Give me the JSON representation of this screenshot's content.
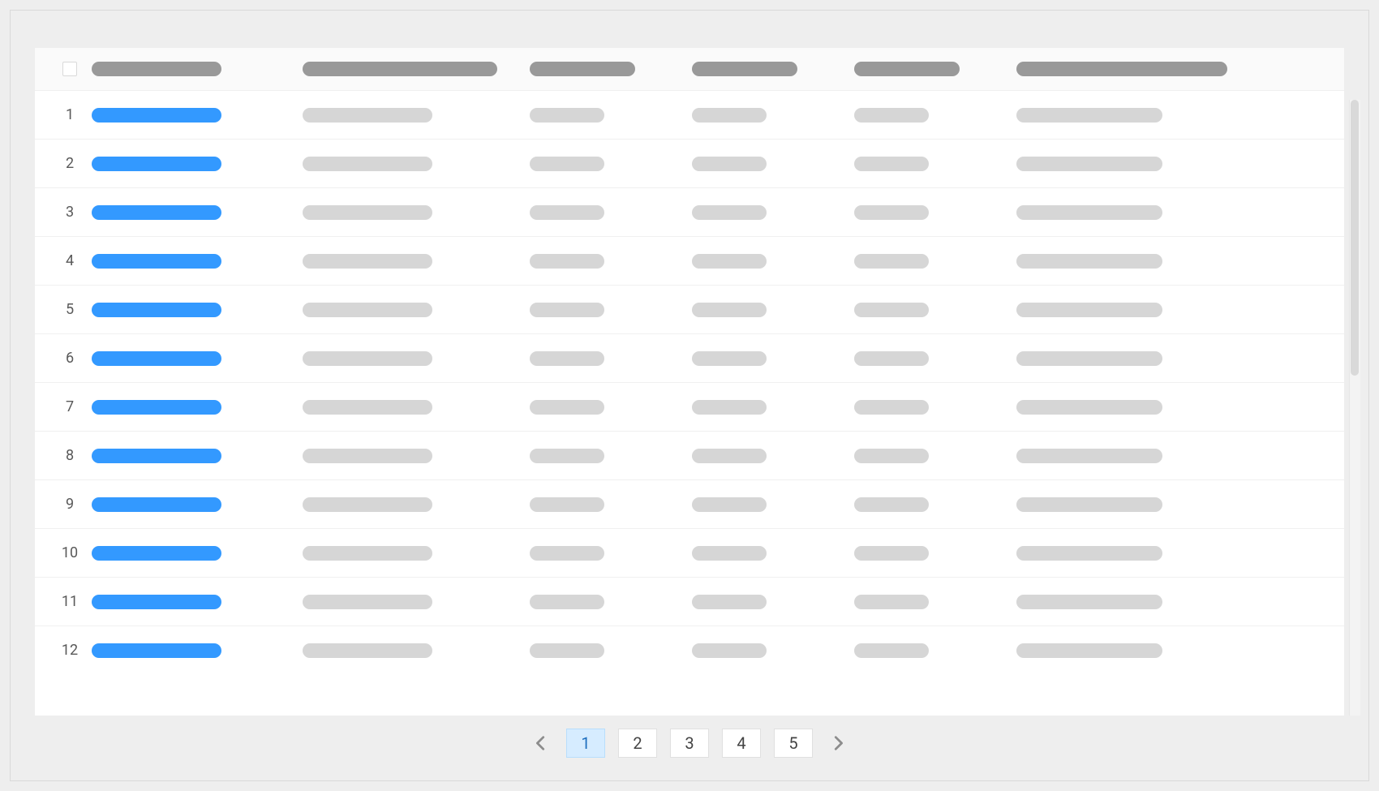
{
  "table": {
    "rows": [
      {
        "num": "1"
      },
      {
        "num": "2"
      },
      {
        "num": "3"
      },
      {
        "num": "4"
      },
      {
        "num": "5"
      },
      {
        "num": "6"
      },
      {
        "num": "7"
      },
      {
        "num": "8"
      },
      {
        "num": "9"
      },
      {
        "num": "10"
      },
      {
        "num": "11"
      },
      {
        "num": "12"
      }
    ]
  },
  "pagination": {
    "pages": [
      "1",
      "2",
      "3",
      "4",
      "5"
    ],
    "current": "1"
  }
}
